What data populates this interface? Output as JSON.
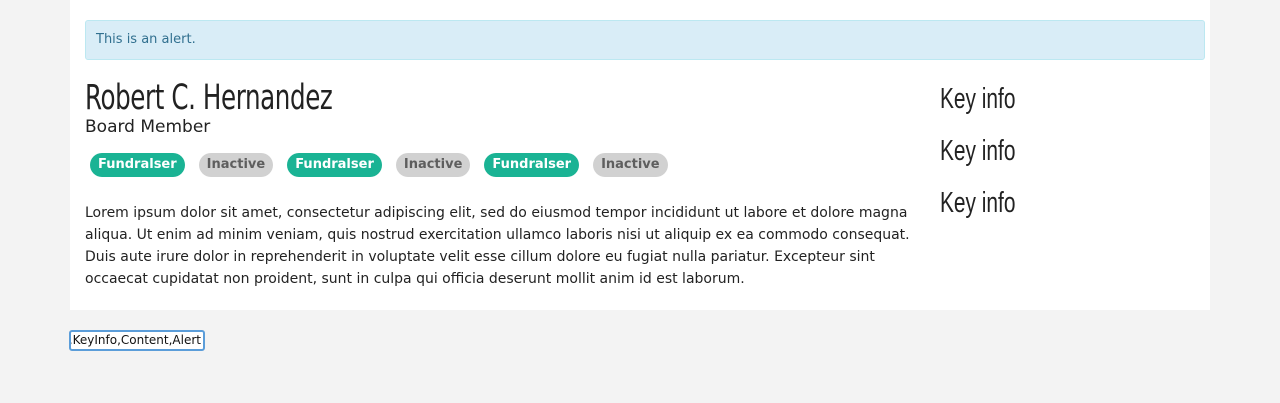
{
  "alert": {
    "text": "This is an alert."
  },
  "profile": {
    "name": "Robert C. Hernandez",
    "role": "Board Member",
    "tags": [
      {
        "label": "Fundralser",
        "status": "fund"
      },
      {
        "label": "Inactive",
        "status": "inactive"
      },
      {
        "label": "Fundralser",
        "status": "fund"
      },
      {
        "label": "Inactive",
        "status": "inactive"
      },
      {
        "label": "Fundralser",
        "status": "fund"
      },
      {
        "label": "Inactive",
        "status": "inactive"
      }
    ],
    "description": "Lorem ipsum dolor sit amet, consectetur adipiscing elit, sed do eiusmod tempor incididunt ut labore et dolore magna aliqua. Ut enim ad minim veniam, quis nostrud exercitation ullamco laboris nisi ut aliquip ex ea commodo consequat. Duis aute irure dolor in reprehenderit in voluptate velit esse cillum dolore eu fugiat nulla pariatur. Excepteur sint occaecat cupidatat non proident, sunt in culpa qui officia deserunt mollit anim id est laborum."
  },
  "key_info": [
    {
      "label": "Key info"
    },
    {
      "label": "Key info"
    },
    {
      "label": "Key info"
    }
  ],
  "input": {
    "value": "s,KeyInfo,Content,Alert"
  },
  "colors": {
    "page_bg": "#f3f3f3",
    "alert_bg": "#d9edf7",
    "alert_text": "#31708f",
    "tag_active": "#1ab394",
    "tag_inactive": "#d1d1d1",
    "input_focus": "#5b9dd9"
  }
}
